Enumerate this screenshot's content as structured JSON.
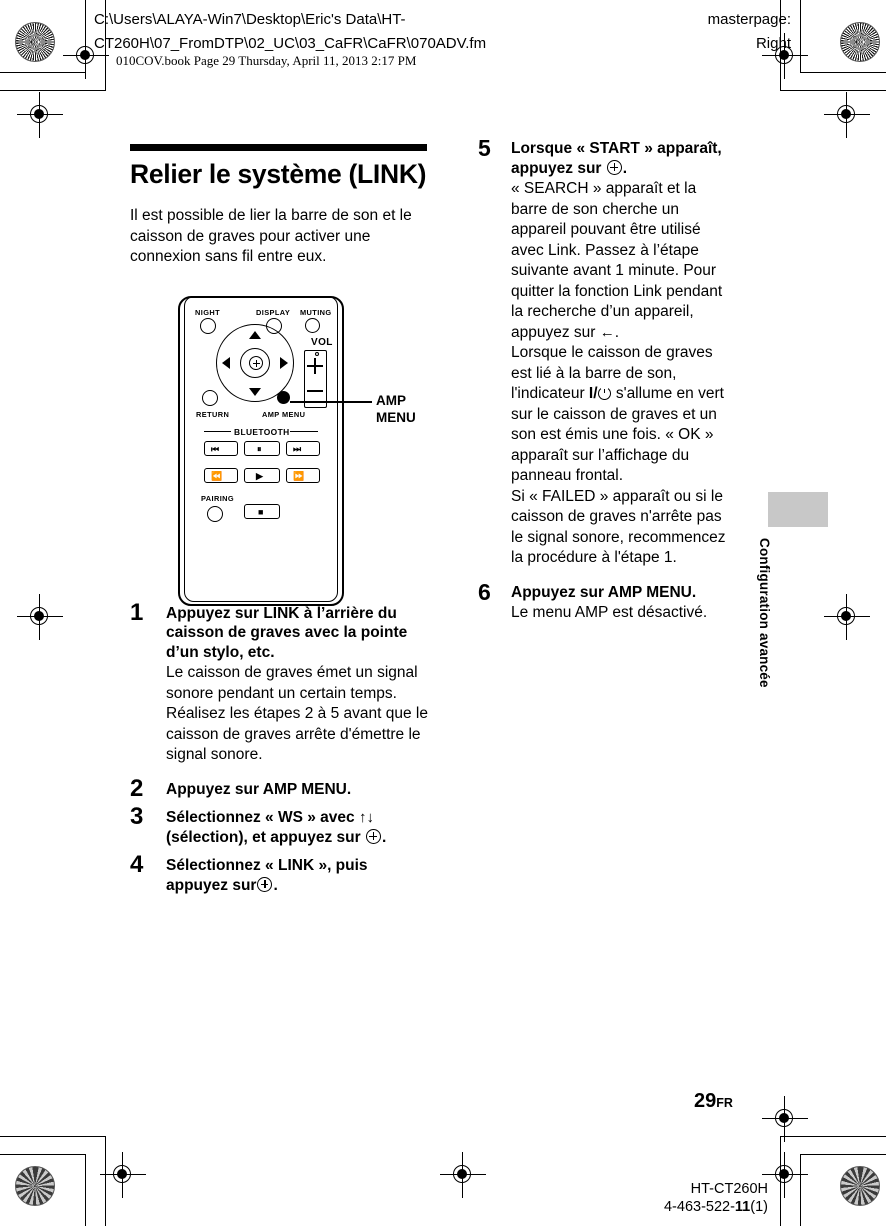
{
  "prepress": {
    "file_path": "C:\\Users\\ALAYA-Win7\\Desktop\\Eric's Data\\HT-\nCT260H\\07_FromDTP\\02_UC\\03_CaFR\\CaFR\\070ADV.fm",
    "masterpage": "masterpage:\nRight",
    "book_line": "010COV.book  Page 29  Thursday, April 11, 2013  2:17 PM"
  },
  "content": {
    "title": "Relier le système (LINK)",
    "intro": "Il est possible de lier la barre de son et le caisson de graves pour activer une connexion sans fil entre eux.",
    "steps": [
      {
        "num": "1",
        "head": "Appuyez sur LINK à l’arrière du caisson de graves avec la pointe d’un stylo, etc.",
        "body": "Le caisson de graves émet un signal sonore pendant un certain temps. Réalisez les étapes 2 à 5 avant que le caisson de graves arrête d'émettre le signal sonore."
      },
      {
        "num": "2",
        "head": "Appuyez sur AMP MENU.",
        "body": ""
      },
      {
        "num": "3",
        "head_part1": "Sélectionnez « WS » avec ",
        "head_arrow_up": "↑",
        "head_arrow_down": "↓",
        "head_part2": " (sélection), et appuyez sur ",
        "head_part3": "."
      },
      {
        "num": "4",
        "head_part1": "Sélectionnez « LINK », puis appuyez sur",
        "head_part2": "."
      },
      {
        "num": "5",
        "head_part1": "Lorsque « START » apparaît, appuyez sur ",
        "head_part2": ".",
        "body_1": "« SEARCH » apparaît et la barre de son cherche un appareil pouvant être utilisé avec Link. Passez à l’étape suivante avant 1 minute. Pour quitter la fonction Link pendant la recherche d’un appareil, appuyez sur ",
        "body_back_arrow": "←",
        "body_2": ".",
        "body_3a": "Lorsque le caisson de graves est lié à la barre de son, l'indicateur ",
        "body_power_prefix": "I/",
        "body_3b": " s'allume en vert sur le caisson de graves et un son est émis une fois. « OK » apparaît sur l’affichage du panneau frontal.",
        "body_4": "Si « FAILED » apparaît ou si le caisson de graves n'arrête pas le signal sonore, recommencez la procédure à l'étape 1."
      },
      {
        "num": "6",
        "head": "Appuyez sur AMP MENU.",
        "body": "Le menu AMP est désactivé."
      }
    ]
  },
  "remote": {
    "labels": {
      "night": "NIGHT",
      "display": "DISPLAY",
      "muting": "MUTING",
      "vol": "VOL",
      "return": "RETURN",
      "amp_menu": "AMP MENU",
      "bluetooth": "BLUETOOTH",
      "pairing": "PAIRING"
    },
    "buttons": {
      "prev": "⏮",
      "pause": "⏸",
      "next": "⏭",
      "rewind": "⏪",
      "play": "▶",
      "fast_forward": "⏩",
      "stop": "■"
    }
  },
  "callout": {
    "label": "AMP\nMENU"
  },
  "side_tab": {
    "chapter": "Configuration avancée"
  },
  "footer": {
    "page_number": "29",
    "page_suffix": "FR",
    "model": "HT-CT260H",
    "doc_number_prefix": "4-463-522-",
    "doc_number_bold": "11",
    "doc_number_suffix": "(1)"
  },
  "colors": {
    "ink": "#000000",
    "tab_gray": "#c8c8c8",
    "paper": "#ffffff"
  }
}
